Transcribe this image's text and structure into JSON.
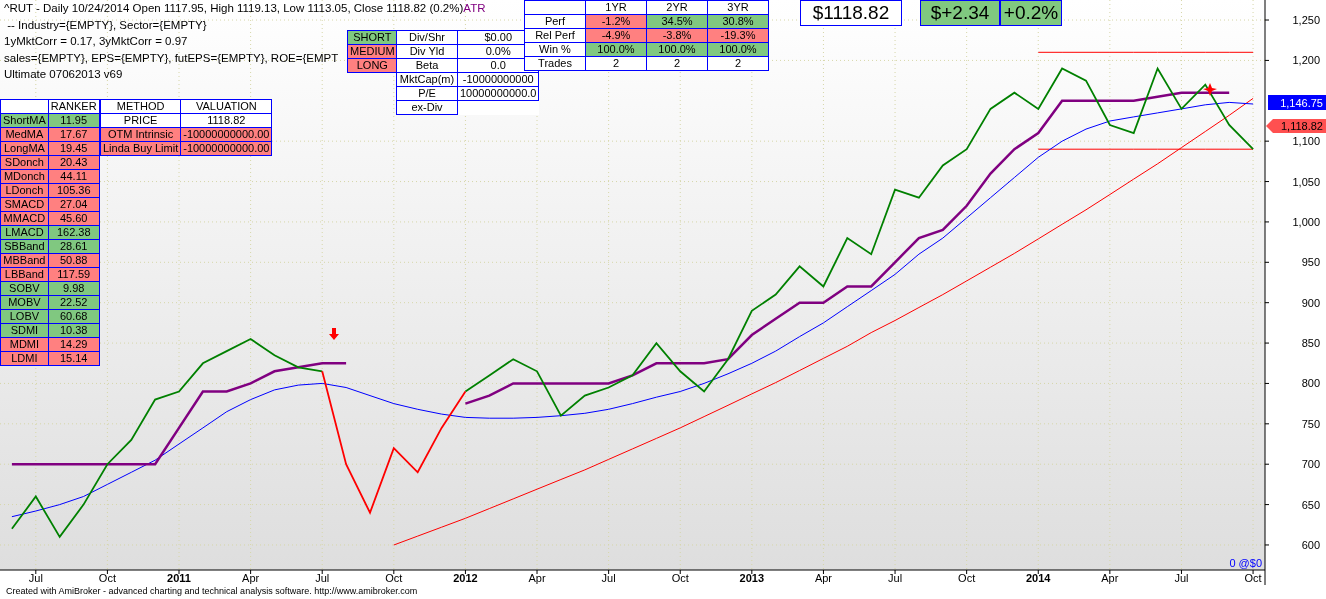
{
  "header": {
    "title": "^RUT - Daily 10/24/2014 Open 1117.95, High 1119.13, Low 1113.05, Close 1118.82 (0.2%)",
    "indicator": "ATR",
    "lines": [
      " -- Industry={EMPTY}, Sector={EMPTY}",
      "1yMktCorr = 0.17, 3yMktCorr = 0.97",
      "sales={EMPTY}, EPS={EMPTY}, futEPS={EMPTY}, ROE={EMPT",
      "Ultimate 07062013 v69"
    ]
  },
  "signals": [
    {
      "label": "SHORT",
      "color": "#80c880"
    },
    {
      "label": "MEDIUM",
      "color": "#ff8080"
    },
    {
      "label": "LONG",
      "color": "#ff8080"
    }
  ],
  "fundamentals": [
    {
      "label": "Div/Shr",
      "value": "$0.00"
    },
    {
      "label": "Div Yld",
      "value": "0.0%"
    },
    {
      "label": "Beta",
      "value": "0.0"
    },
    {
      "label": "MktCap(m)",
      "value": "-10000000000"
    },
    {
      "label": "P/E",
      "value": "10000000000.0"
    },
    {
      "label": "ex-Div"
    }
  ],
  "performance": {
    "columns": [
      "1YR",
      "2YR",
      "3YR"
    ],
    "rows": [
      {
        "label": "Perf",
        "cells": [
          {
            "text": "-1.2%",
            "color": "#ff8080"
          },
          {
            "text": "34.5%",
            "color": "#80c880"
          },
          {
            "text": "30.8%",
            "color": "#80c880"
          }
        ]
      },
      {
        "label": "Rel Perf",
        "cells": [
          {
            "text": "-4.9%",
            "color": "#ff8080"
          },
          {
            "text": "-3.8%",
            "color": "#ff8080"
          },
          {
            "text": "-19.3%",
            "color": "#ff8080"
          }
        ]
      },
      {
        "label": "Win %",
        "cells": [
          {
            "text": "100.0%",
            "color": "#80c880"
          },
          {
            "text": "100.0%",
            "color": "#80c880"
          },
          {
            "text": "100.0%",
            "color": "#80c880"
          }
        ]
      },
      {
        "label": "Trades",
        "cells": [
          {
            "text": "2"
          },
          {
            "text": "2"
          },
          {
            "text": "2"
          }
        ]
      }
    ]
  },
  "quote": {
    "price": "$1118.82",
    "change": {
      "text": "$+2.34",
      "color": "#80c880"
    },
    "percent": {
      "text": "+0.2%",
      "color": "#80c880"
    }
  },
  "ranker": {
    "heading": "RANKER",
    "rows": [
      {
        "label": "ShortMA",
        "value": "11.95",
        "color": "#80c880"
      },
      {
        "label": "MedMA",
        "value": "17.67",
        "color": "#ff8080"
      },
      {
        "label": "LongMA",
        "value": "19.45",
        "color": "#ff8080"
      },
      {
        "label": "SDonch",
        "value": "20.43",
        "color": "#ff8080"
      },
      {
        "label": "MDonch",
        "value": "44.11",
        "color": "#ff8080"
      },
      {
        "label": "LDonch",
        "value": "105.36",
        "color": "#ff8080"
      },
      {
        "label": "SMACD",
        "value": "27.04",
        "color": "#ff8080"
      },
      {
        "label": "MMACD",
        "value": "45.60",
        "color": "#ff8080"
      },
      {
        "label": "LMACD",
        "value": "162.38",
        "color": "#80c880"
      },
      {
        "label": "SBBand",
        "value": "28.61",
        "color": "#80c880"
      },
      {
        "label": "MBBand",
        "value": "50.88",
        "color": "#ff8080"
      },
      {
        "label": "LBBand",
        "value": "117.59",
        "color": "#ff8080"
      },
      {
        "label": "SOBV",
        "value": "9.98",
        "color": "#80c880"
      },
      {
        "label": "MOBV",
        "value": "22.52",
        "color": "#80c880"
      },
      {
        "label": "LOBV",
        "value": "60.68",
        "color": "#80c880"
      },
      {
        "label": "SDMI",
        "value": "10.38",
        "color": "#80c880"
      },
      {
        "label": "MDMI",
        "value": "14.29",
        "color": "#ff8080"
      },
      {
        "label": "LDMI",
        "value": "15.14",
        "color": "#ff8080"
      }
    ]
  },
  "valuation": {
    "columns": [
      "METHOD",
      "VALUATION"
    ],
    "rows": [
      {
        "method": "PRICE",
        "value": "1118.82"
      },
      {
        "method": "OTM Intrinsic",
        "value": "-10000000000.00",
        "color": "#ff8080"
      },
      {
        "method": "Linda Buy Limit",
        "value": "-10000000000.00",
        "color": "#ff8080"
      }
    ]
  },
  "chart": {
    "chart_data": {
      "type": "line",
      "categories": [
        null,
        "Jul",
        null,
        null,
        "Oct",
        null,
        null,
        "2011",
        null,
        null,
        "Apr",
        null,
        null,
        "Jul",
        null,
        null,
        "Oct",
        null,
        null,
        "2012",
        null,
        null,
        "Apr",
        null,
        null,
        "Jul",
        null,
        null,
        "Oct",
        null,
        null,
        "2013",
        null,
        null,
        "Apr",
        null,
        null,
        "Jul",
        null,
        null,
        "Oct",
        null,
        null,
        "2014",
        null,
        null,
        "Apr",
        null,
        null,
        "Jul",
        null,
        null,
        "Oct"
      ],
      "series": [
        {
          "color": "#ff0000",
          "values": [
            null,
            null,
            null,
            null,
            null,
            null,
            null,
            null,
            null,
            null,
            null,
            null,
            null,
            null,
            null,
            null,
            600,
            611,
            622,
            633,
            645,
            657,
            669,
            681,
            693,
            706,
            719,
            732,
            745,
            759,
            773,
            787,
            801,
            816,
            831,
            846,
            863,
            878,
            894,
            910,
            927,
            944,
            961,
            979,
            997,
            1015,
            1034,
            1053,
            1072,
            1092,
            1112,
            1132,
            1153
          ]
        },
        {
          "color": "#ff0000",
          "values": [
            null,
            null,
            null,
            null,
            null,
            null,
            null,
            null,
            null,
            null,
            null,
            null,
            null,
            null,
            null,
            null,
            null,
            null,
            null,
            null,
            null,
            null,
            null,
            null,
            null,
            null,
            null,
            null,
            null,
            null,
            null,
            null,
            null,
            null,
            null,
            null,
            null,
            null,
            null,
            null,
            null,
            null,
            null,
            1210,
            1210,
            1210,
            1210,
            1210,
            1210,
            1210,
            1210,
            1210,
            1210
          ]
        },
        {
          "color": "#ff0000",
          "values": [
            null,
            null,
            null,
            null,
            null,
            null,
            null,
            null,
            null,
            null,
            null,
            null,
            null,
            null,
            null,
            null,
            null,
            null,
            null,
            null,
            null,
            null,
            null,
            null,
            null,
            null,
            null,
            null,
            null,
            null,
            null,
            null,
            null,
            null,
            null,
            null,
            null,
            null,
            null,
            null,
            null,
            null,
            null,
            1090,
            1090,
            1090,
            1090,
            1090,
            1090,
            1090,
            1090,
            1090,
            1090
          ]
        },
        {
          "color": "#0000ff",
          "values": [
            635,
            642,
            650,
            660,
            675,
            690,
            705,
            725,
            745,
            765,
            780,
            792,
            798,
            800,
            795,
            785,
            775,
            768,
            762,
            758,
            757,
            757,
            758,
            760,
            763,
            768,
            775,
            783,
            790,
            800,
            812,
            825,
            840,
            858,
            875,
            895,
            915,
            935,
            960,
            980,
            1005,
            1030,
            1055,
            1080,
            1100,
            1115,
            1125,
            1130,
            1135,
            1140,
            1145,
            1148,
            1146
          ]
        },
        {
          "color": "#800080",
          "values": [
            700,
            700,
            700,
            700,
            700,
            700,
            700,
            745,
            790,
            790,
            800,
            815,
            820,
            825,
            825,
            null,
            null,
            null,
            null,
            775,
            785,
            800,
            800,
            800,
            800,
            800,
            810,
            825,
            825,
            825,
            830,
            860,
            880,
            900,
            900,
            920,
            920,
            950,
            980,
            990,
            1020,
            1060,
            1090,
            1110,
            1150,
            1150,
            1150,
            1150,
            1155,
            1160,
            1160,
            1160,
            null
          ]
        },
        {
          "color": "#008000",
          "values": [
            620,
            660,
            610,
            650,
            700,
            730,
            780,
            790,
            825,
            840,
            855,
            835,
            820,
            815,
            null,
            null,
            null,
            null,
            null,
            790,
            810,
            830,
            815,
            760,
            785,
            795,
            810,
            850,
            815,
            790,
            830,
            890,
            910,
            945,
            920,
            980,
            960,
            1040,
            1030,
            1070,
            1090,
            1140,
            1160,
            1140,
            1190,
            1175,
            1120,
            1110,
            1190,
            1140,
            1170,
            1120,
            1090
          ]
        },
        {
          "color": "#ff0000",
          "values": [
            null,
            null,
            null,
            null,
            null,
            null,
            null,
            null,
            null,
            null,
            null,
            null,
            null,
            815,
            700,
            640,
            720,
            690,
            745,
            790,
            null,
            null,
            null,
            null,
            null,
            null,
            null,
            null,
            null,
            null,
            null,
            null,
            null,
            null,
            null,
            null,
            null,
            null,
            null,
            null,
            null,
            null,
            null,
            null,
            null,
            null,
            null,
            null,
            null,
            null,
            null,
            null,
            null
          ]
        }
      ],
      "ylim": [
        569,
        1274.8
      ],
      "grid": true,
      "yticks": [
        {
          "value": 600,
          "label": "600"
        },
        {
          "value": 650,
          "label": "650"
        },
        {
          "value": 700,
          "label": "700"
        },
        {
          "value": 750,
          "label": "750"
        },
        {
          "value": 800,
          "label": "800"
        },
        {
          "value": 850,
          "label": "850"
        },
        {
          "value": 900,
          "label": "900"
        },
        {
          "value": 950,
          "label": "950"
        },
        {
          "value": 1000,
          "label": "1,000"
        },
        {
          "value": 1050,
          "label": "1,050"
        },
        {
          "value": 1100,
          "label": "1,100"
        },
        {
          "value": 1200,
          "label": "1,200"
        },
        {
          "value": 1250,
          "label": "1,250"
        }
      ]
    },
    "price_tags": [
      {
        "text": "1,146.75",
        "kind": "box",
        "color": "#0000ff"
      },
      {
        "text": "1,118.82",
        "kind": "arrow",
        "color": "#ff5050"
      }
    ],
    "position_note": "0 @$0"
  },
  "footer": "Created with AmiBroker - advanced charting and technical analysis software. http://www.amibroker.com"
}
